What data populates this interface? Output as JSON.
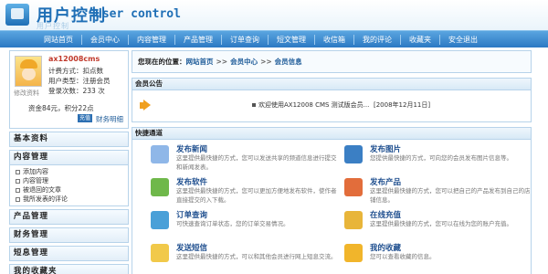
{
  "header": {
    "logo_cn": "用户控制",
    "logo_en": "user control",
    "logo_reflect": "用户控制"
  },
  "nav": {
    "items": [
      "网站首页",
      "会员中心",
      "内容管理",
      "产品管理",
      "订单查询",
      "短文管理",
      "收信箱",
      "我的评论",
      "收藏夹",
      "安全退出"
    ]
  },
  "user": {
    "name": "ax12008cms",
    "points_label": "计费方式：扣点数",
    "group_label": "用户类型：注册会员",
    "logins_label": "登录次数：233 次",
    "edit_profile": "修改资料",
    "balance": "资金84元，积分22点",
    "charge_button": "充值",
    "finance_link": "财务明细"
  },
  "sidebar": {
    "basic": "基本资料",
    "content": "内容管理",
    "content_items": [
      "添加内容",
      "内容管理",
      "被退回的文章",
      "我所发表的评论"
    ],
    "product": "产品管理",
    "finance": "财务管理",
    "sms": "短息管理",
    "favorites": "我的收藏夹"
  },
  "breadcrumb": {
    "label": "您现在的位置：",
    "items": [
      "网站首页",
      "会员中心",
      "会员信息"
    ],
    "sep": ">>"
  },
  "announcement": {
    "title": "会员公告",
    "text": "欢迎使用AX12008 CMS 测试版会员...",
    "date": "[2008年12月11日]"
  },
  "quick": {
    "title": "快捷通道",
    "items": [
      {
        "title": "发布新闻",
        "desc": "这里提供最快捷的方式，您可以发送共享的频道信息进行提交和新闻发表。",
        "color": "#8fb7e8"
      },
      {
        "title": "发布图片",
        "desc": "您提供最快捷的方式，可向您的会员发布图片信息等。",
        "color": "#3b7fc4"
      },
      {
        "title": "发布软件",
        "desc": "这里提供最快捷的方式，您可以更加方便地发布软件，使作者直接提交的入下载。",
        "color": "#6fb84a"
      },
      {
        "title": "发布产品",
        "desc": "这里提供最快捷的方式，您可以把自己的产品发布到自己的店铺信息。",
        "color": "#e26d3b"
      },
      {
        "title": "订单查询",
        "desc": "可快速查询订单状态，您的订单交易情况。",
        "color": "#4aa0d8"
      },
      {
        "title": "在线充值",
        "desc": "这里提供最快捷的方式，您可以在线为您的账户充值。",
        "color": "#e8b53a"
      },
      {
        "title": "发送短信",
        "desc": "这里提供最快捷的方式，可以和其他会员进行网上短息交流。",
        "color": "#f1c94a"
      },
      {
        "title": "我的收藏",
        "desc": "您可以查看收藏的信息。",
        "color": "#f1b52b"
      }
    ]
  }
}
